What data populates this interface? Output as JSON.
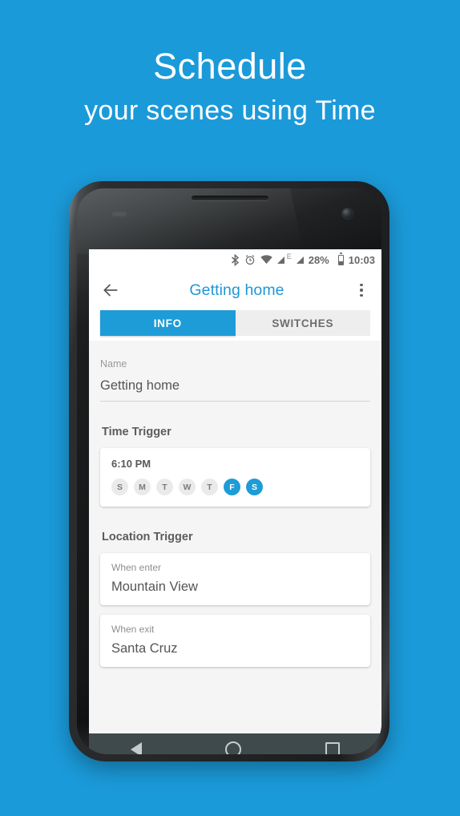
{
  "promo": {
    "title": "Schedule",
    "subtitle": "your scenes using Time"
  },
  "colors": {
    "background_blue": "#1b9ad9",
    "accent_blue": "#1e9cd7",
    "title_blue": "#2196d6",
    "screen_bg": "#f5f5f5",
    "navbar": "#3f4a4c"
  },
  "status_bar": {
    "bluetooth_icon": "bluetooth-icon",
    "alarm_icon": "alarm-clock-icon",
    "wifi_icon": "wifi-icon",
    "signal_icon": "signal-icon",
    "network_type": "E",
    "signal2_icon": "signal-icon",
    "battery_percent": "28%",
    "battery_icon": "battery-icon",
    "clock": "10:03"
  },
  "toolbar": {
    "back_icon": "back-arrow-icon",
    "title": "Getting home",
    "overflow_icon": "overflow-menu-icon"
  },
  "tabs": [
    {
      "label": "INFO",
      "active": true
    },
    {
      "label": "SWITCHES",
      "active": false
    }
  ],
  "form": {
    "name_label": "Name",
    "name_value": "Getting home"
  },
  "time_trigger": {
    "section_title": "Time Trigger",
    "time": "6:10 PM",
    "days": [
      {
        "letter": "S",
        "selected": false
      },
      {
        "letter": "M",
        "selected": false
      },
      {
        "letter": "T",
        "selected": false
      },
      {
        "letter": "W",
        "selected": false
      },
      {
        "letter": "T",
        "selected": false
      },
      {
        "letter": "F",
        "selected": true
      },
      {
        "letter": "S",
        "selected": true
      }
    ]
  },
  "location_trigger": {
    "section_title": "Location Trigger",
    "entries": [
      {
        "label": "When enter",
        "value": "Mountain View"
      },
      {
        "label": "When exit",
        "value": "Santa Cruz"
      }
    ]
  },
  "nav_bar": {
    "back_icon": "nav-back-icon",
    "home_icon": "nav-home-icon",
    "recents_icon": "nav-recents-icon"
  }
}
